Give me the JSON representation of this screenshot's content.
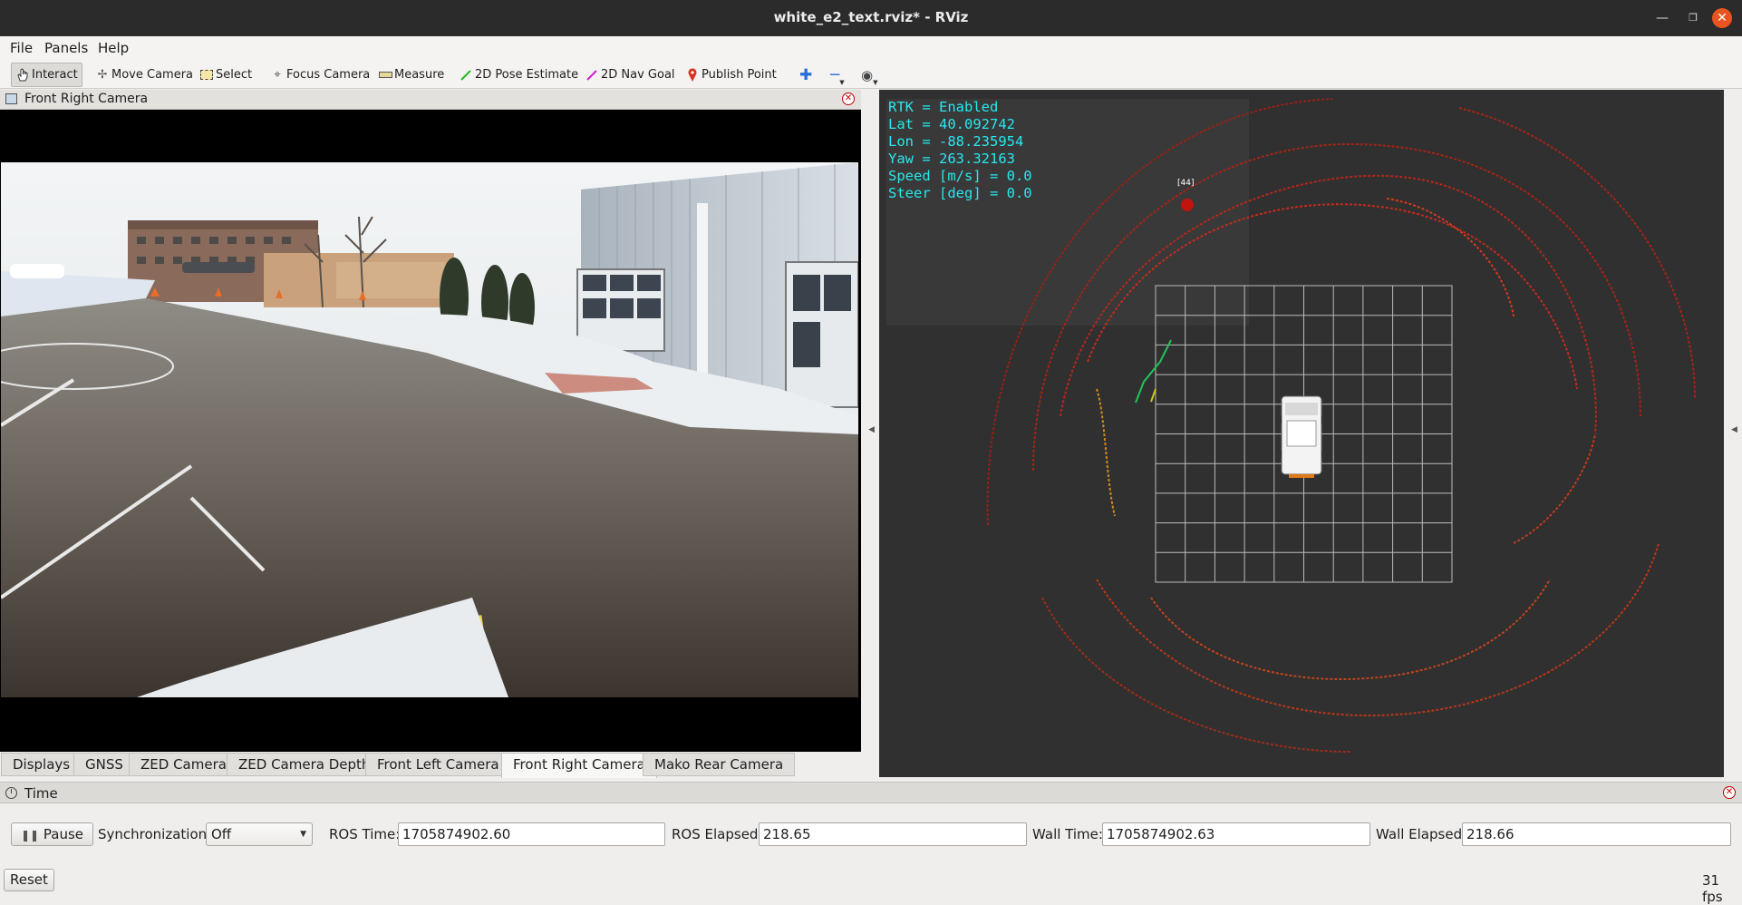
{
  "window": {
    "title": "white_e2_text.rviz* - RViz"
  },
  "menu": [
    "File",
    "Panels",
    "Help"
  ],
  "toolbar": {
    "interact": "Interact",
    "move_camera": "Move Camera",
    "select": "Select",
    "focus_camera": "Focus Camera",
    "measure": "Measure",
    "pose_estimate": "2D Pose Estimate",
    "nav_goal": "2D Nav Goal",
    "publish_point": "Publish Point"
  },
  "camera_panel": {
    "title": "Front Right Camera"
  },
  "tabs": [
    "Displays",
    "GNSS",
    "ZED Camera",
    "ZED Camera Depth",
    "Front Left Camera",
    "Front Right Camera",
    "Mako Rear Camera"
  ],
  "selected_tab": "Front Right Camera",
  "overlay": {
    "rtk": "RTK = Enabled",
    "lat": "Lat = 40.092742",
    "lon": "Lon = -88.235954",
    "yaw": "Yaw = 263.32163",
    "speed": "Speed [m/s] = 0.0",
    "steer": "Steer [deg] = 0.0"
  },
  "marker_label": "[44]",
  "time_panel": {
    "title": "Time",
    "pause": "Pause",
    "sync_label": "Synchronization:",
    "sync_value": "Off",
    "ros_time_label": "ROS Time:",
    "ros_time": "1705874902.60",
    "ros_elapsed_label": "ROS Elapsed:",
    "ros_elapsed": "218.65",
    "wall_time_label": "Wall Time:",
    "wall_time": "1705874902.63",
    "wall_elapsed_label": "Wall Elapsed:",
    "wall_elapsed": "218.66"
  },
  "reset": "Reset",
  "fps": "31 fps",
  "colors": {
    "overlay_text": "#27e8ee",
    "title_bar": "#2b2b2b",
    "view_bg": "#303030",
    "close_button": "#e95420"
  }
}
